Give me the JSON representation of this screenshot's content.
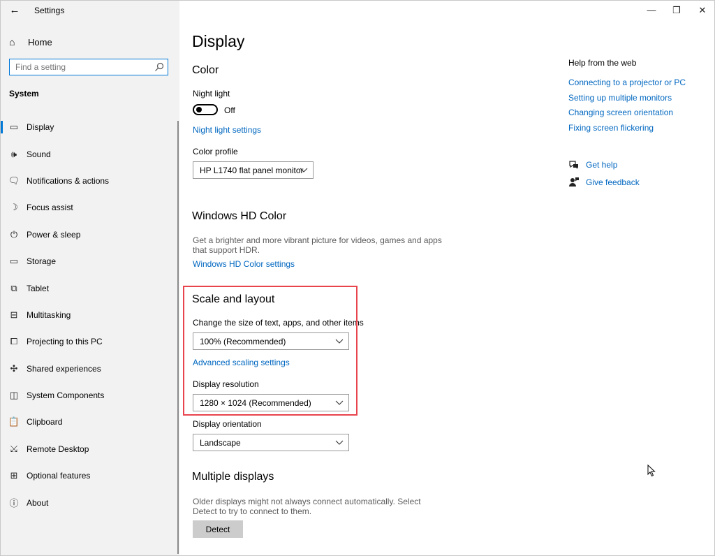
{
  "window": {
    "title": "Settings",
    "controls": {
      "minimize": "—",
      "restore": "❐",
      "close": "✕"
    }
  },
  "sidebar": {
    "home_label": "Home",
    "search_placeholder": "Find a setting",
    "section_label": "System",
    "items": [
      {
        "label": "Display",
        "icon": "monitor-icon",
        "glyph": "▭",
        "selected": true
      },
      {
        "label": "Sound",
        "icon": "speaker-icon",
        "glyph": "🕪"
      },
      {
        "label": "Notifications & actions",
        "icon": "notification-icon",
        "glyph": "🗨"
      },
      {
        "label": "Focus assist",
        "icon": "moon-icon",
        "glyph": "☽"
      },
      {
        "label": "Power & sleep",
        "icon": "power-icon",
        "glyph": "⏻"
      },
      {
        "label": "Storage",
        "icon": "storage-icon",
        "glyph": "▭"
      },
      {
        "label": "Tablet",
        "icon": "tablet-icon",
        "glyph": "⧉"
      },
      {
        "label": "Multitasking",
        "icon": "multitasking-icon",
        "glyph": "⊟"
      },
      {
        "label": "Projecting to this PC",
        "icon": "projector-icon",
        "glyph": "⧠"
      },
      {
        "label": "Shared experiences",
        "icon": "shared-experiences-icon",
        "glyph": "✣"
      },
      {
        "label": "System Components",
        "icon": "components-icon",
        "glyph": "◫"
      },
      {
        "label": "Clipboard",
        "icon": "clipboard-icon",
        "glyph": "📋"
      },
      {
        "label": "Remote Desktop",
        "icon": "remote-desktop-icon",
        "glyph": "⤩"
      },
      {
        "label": "Optional features",
        "icon": "optional-features-icon",
        "glyph": "⊞"
      },
      {
        "label": "About",
        "icon": "info-icon",
        "glyph": "ⓘ"
      }
    ]
  },
  "main": {
    "title": "Display",
    "color": {
      "heading": "Color",
      "night_light_label": "Night light",
      "night_light_state": "Off",
      "night_light_settings_link": "Night light settings",
      "color_profile_label": "Color profile",
      "color_profile_value": "HP L1740 flat panel monitor"
    },
    "hd_color": {
      "heading": "Windows HD Color",
      "description": "Get a brighter and more vibrant picture for videos, games and apps that support HDR.",
      "settings_link": "Windows HD Color settings"
    },
    "scale_layout": {
      "heading": "Scale and layout",
      "size_label": "Change the size of text, apps, and other items",
      "size_value": "100% (Recommended)",
      "advanced_link": "Advanced scaling settings",
      "resolution_label": "Display resolution",
      "resolution_value": "1280 × 1024 (Recommended)",
      "orientation_label": "Display orientation",
      "orientation_value": "Landscape"
    },
    "multiple_displays": {
      "heading": "Multiple displays",
      "description": "Older displays might not always connect automatically. Select Detect to try to connect to them.",
      "detect_button": "Detect"
    }
  },
  "help": {
    "title": "Help from the web",
    "links": [
      "Connecting to a projector or PC",
      "Setting up multiple monitors",
      "Changing screen orientation",
      "Fixing screen flickering"
    ],
    "get_help": "Get help",
    "give_feedback": "Give feedback"
  },
  "colors": {
    "accent": "#0078d7",
    "link": "#0067c0",
    "highlight_border": "#e8444d",
    "sidebar_bg": "#f2f2f2"
  }
}
